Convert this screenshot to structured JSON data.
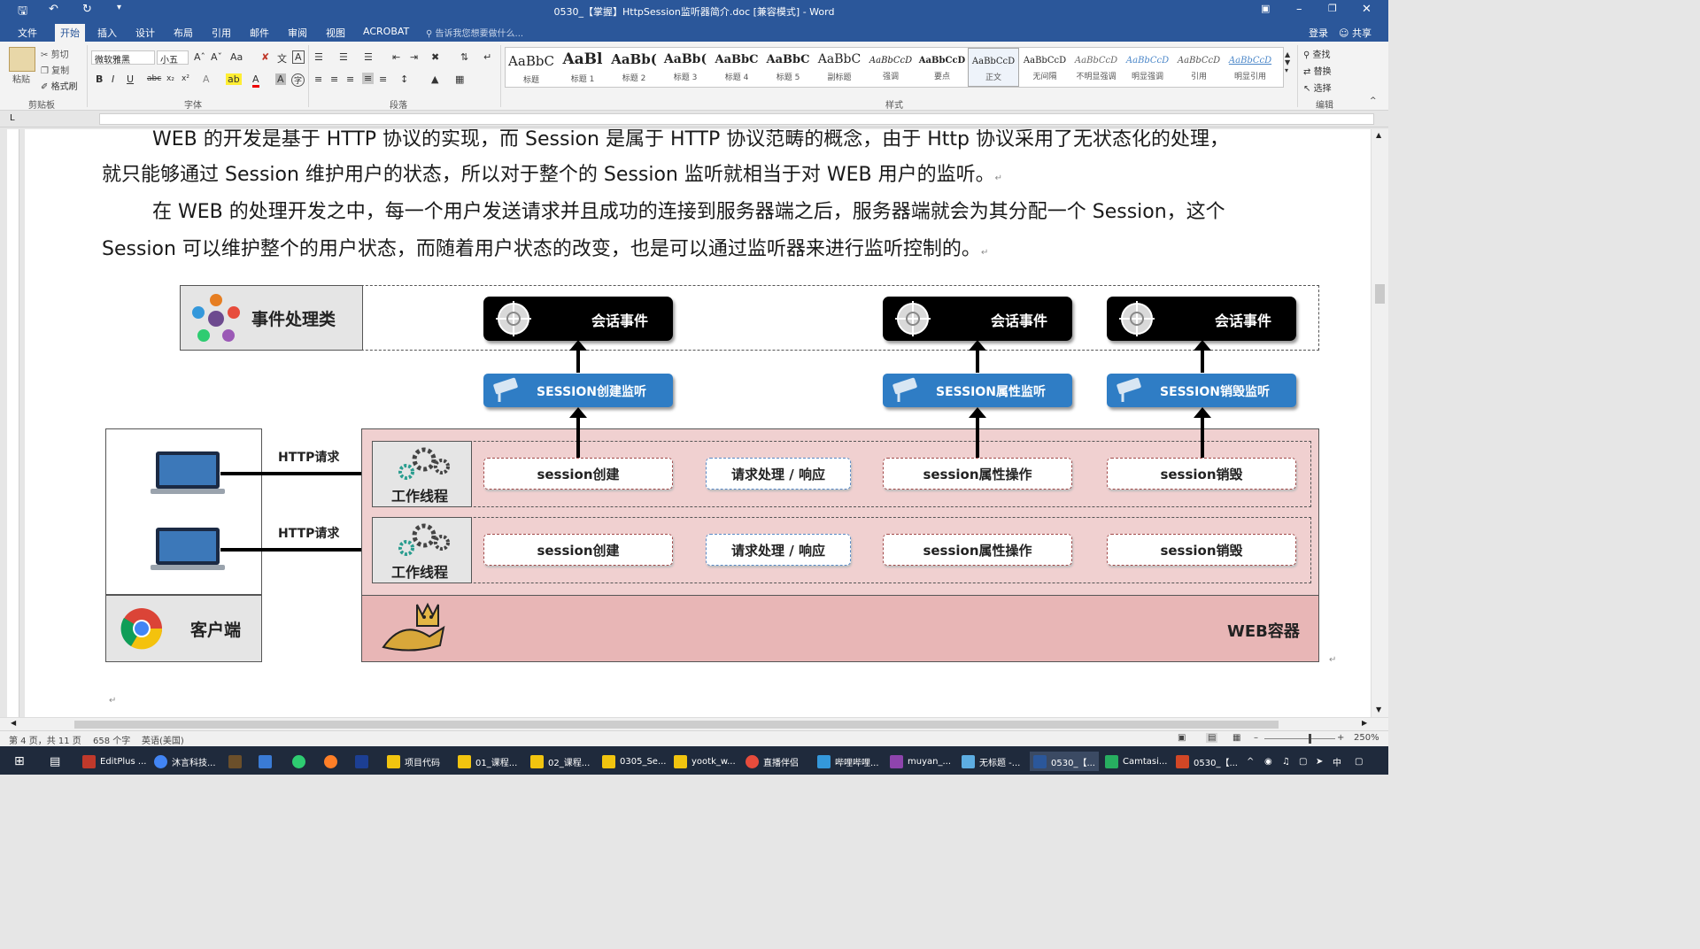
{
  "window": {
    "title": "0530_【掌握】HttpSession监听器简介.doc [兼容模式] - Word"
  },
  "tabs": [
    "文件",
    "开始",
    "插入",
    "设计",
    "布局",
    "引用",
    "邮件",
    "审阅",
    "视图",
    "ACROBAT"
  ],
  "tell_me": "告诉我您想要做什么...",
  "account": {
    "login": "登录",
    "share": "共享"
  },
  "clipboard": {
    "paste": "粘贴",
    "cut": "剪切",
    "copy": "复制",
    "format_painter": "格式刷",
    "group": "剪贴板"
  },
  "font": {
    "name": "微软雅黑",
    "size": "小五",
    "group": "字体",
    "case": "Aa"
  },
  "paragraph": {
    "group": "段落"
  },
  "styles": {
    "group": "样式",
    "items": [
      {
        "preview": "AaBbC",
        "name": "标题"
      },
      {
        "preview": "AaBl",
        "name": "标题 1"
      },
      {
        "preview": "AaBb(",
        "name": "标题 2"
      },
      {
        "preview": "AaBb(",
        "name": "标题 3"
      },
      {
        "preview": "AaBbC",
        "name": "标题 4"
      },
      {
        "preview": "AaBbC",
        "name": "标题 5"
      },
      {
        "preview": "AaBbC",
        "name": "副标题"
      },
      {
        "preview": "AaBbCcD",
        "name": "强调"
      },
      {
        "preview": "AaBbCcD",
        "name": "要点"
      },
      {
        "preview": "AaBbCcD",
        "name": "正文"
      },
      {
        "preview": "AaBbCcD",
        "name": "无间隔"
      },
      {
        "preview": "AaBbCcD",
        "name": "不明显强调"
      },
      {
        "preview": "AaBbCcD",
        "name": "明显强调"
      },
      {
        "preview": "AaBbCcD",
        "name": "引用"
      },
      {
        "preview": "AaBbCcD",
        "name": "明显引用"
      }
    ]
  },
  "editing": {
    "find": "查找",
    "replace": "替换",
    "select": "选择",
    "group": "编辑"
  },
  "document": {
    "line1": "WEB 的开发是基于 HTTP 协议的实现，而 Session 是属于 HTTP 协议范畴的概念，由于 Http 协议采用了无状态化的处理，",
    "line2": "就只能够通过 Session 维护用户的状态，所以对于整个的 Session 监听就相当于对 WEB 用户的监听。",
    "line3": "在 WEB 的处理开发之中，每一个用户发送请求并且成功的连接到服务器端之后，服务器端就会为其分配一个 Session，这个",
    "line4": "Session 可以维护整个的用户状态，而随着用户状态的改变，也是可以通过监听器来进行监听控制的。",
    "para_mark": "↵"
  },
  "diagram": {
    "event_handler": "事件处理类",
    "session_event": "会话事件",
    "listeners": [
      "SESSION创建监听",
      "SESSION属性监听",
      "SESSION销毁监听"
    ],
    "http_request": "HTTP请求",
    "worker_thread": "工作线程",
    "ops": [
      "session创建",
      "请求处理 / 响应",
      "session属性操作",
      "session销毁"
    ],
    "client": "客户端",
    "web_container": "WEB容器"
  },
  "status": {
    "page": "第 4 页，共 11 页",
    "words": "658 个字",
    "lang": "英语(美国)",
    "zoom": "250%"
  },
  "taskbar": [
    {
      "label": "EditPlus ...",
      "color": "#c0392b"
    },
    {
      "label": "沐言科技...",
      "color": "#4285f4"
    },
    {
      "label": "",
      "color": "#6b4f2a"
    },
    {
      "label": "",
      "color": "#3a7bd5"
    },
    {
      "label": "",
      "color": "#2ecc71"
    },
    {
      "label": "",
      "color": "#ff7f27"
    },
    {
      "label": "",
      "color": "#1c3f94"
    },
    {
      "label": "项目代码",
      "color": "#f1c40f"
    },
    {
      "label": "01_课程...",
      "color": "#f1c40f"
    },
    {
      "label": "02_课程...",
      "color": "#f1c40f"
    },
    {
      "label": "0305_Se...",
      "color": "#f1c40f"
    },
    {
      "label": "yootk_w...",
      "color": "#f1c40f"
    },
    {
      "label": "直播伴侣",
      "color": "#e74c3c"
    },
    {
      "label": "哔哩哔哩...",
      "color": "#3498db"
    },
    {
      "label": "muyan_...",
      "color": "#8e44ad"
    },
    {
      "label": "无标题 -...",
      "color": "#5dade2"
    },
    {
      "label": "0530_【...",
      "color": "#2b579a"
    },
    {
      "label": "Camtasi...",
      "color": "#27ae60"
    },
    {
      "label": "0530_【...",
      "color": "#d24726"
    }
  ],
  "tray": {
    "ime": "中"
  }
}
